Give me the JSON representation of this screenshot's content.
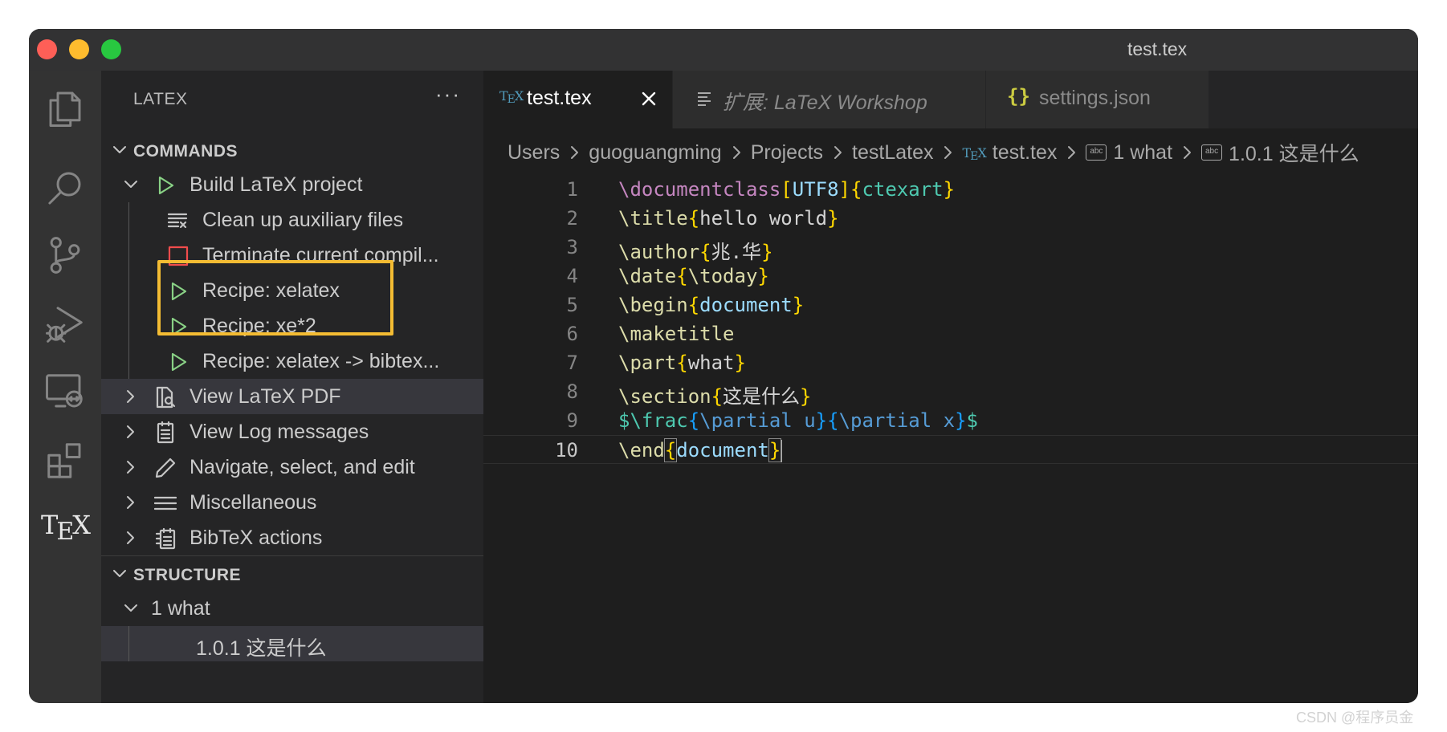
{
  "window": {
    "title": "test.tex"
  },
  "activity_bar": {
    "icons": [
      "explorer-icon",
      "search-icon",
      "source-control-icon",
      "run-debug-icon",
      "remote-explorer-icon",
      "extensions-icon",
      "tex-icon"
    ],
    "tex_label": "TEX"
  },
  "sidebar": {
    "title": "LATEX",
    "more": "···",
    "commands": {
      "header": "COMMANDS",
      "items": [
        {
          "label": "Build LaTeX project",
          "icon": "play-icon"
        },
        {
          "label": "Clean up auxiliary files",
          "icon": "clear-all-icon"
        },
        {
          "label": "Terminate current compil...",
          "icon": "stop-icon"
        },
        {
          "label": "Recipe: xelatex",
          "icon": "play-icon"
        },
        {
          "label": "Recipe: xe*2",
          "icon": "play-icon"
        },
        {
          "label": "Recipe: xelatex -> bibtex...",
          "icon": "play-icon"
        },
        {
          "label": "View LaTeX PDF",
          "icon": "preview-icon"
        },
        {
          "label": "View Log messages",
          "icon": "log-icon"
        },
        {
          "label": "Navigate, select, and edit",
          "icon": "edit-icon"
        },
        {
          "label": "Miscellaneous",
          "icon": "list-icon"
        },
        {
          "label": "BibTeX actions",
          "icon": "bibtex-icon"
        }
      ]
    },
    "structure": {
      "header": "STRUCTURE",
      "items": [
        {
          "label": "1 what"
        },
        {
          "label": "1.0.1 这是什么"
        }
      ]
    }
  },
  "tabs": [
    {
      "label": "test.tex",
      "icon": "tex-file-icon",
      "active": true
    },
    {
      "label": "扩展: LaTeX Workshop",
      "icon": "preview-lines-icon",
      "active": false
    },
    {
      "label": "settings.json",
      "icon": "json-icon",
      "active": false
    }
  ],
  "breadcrumb": [
    "Users",
    "guoguangming",
    "Projects",
    "testLatex",
    "test.tex",
    "1 what",
    "1.0.1 这是什么"
  ],
  "editor": {
    "line_numbers": [
      "1",
      "2",
      "3",
      "4",
      "5",
      "6",
      "7",
      "8",
      "9",
      "10"
    ],
    "current_line": "10",
    "lines": [
      "\\documentclass[UTF8]{ctexart}",
      "\\title{hello world}",
      "\\author{兆.华}",
      "\\date{\\today}",
      "\\begin{document}",
      "\\maketitle",
      "\\part{what}",
      "\\section{这是什么}",
      "$\\frac{\\partial u}{\\partial x}$",
      "\\end{document}"
    ]
  },
  "watermark": "CSDN @程序员金"
}
